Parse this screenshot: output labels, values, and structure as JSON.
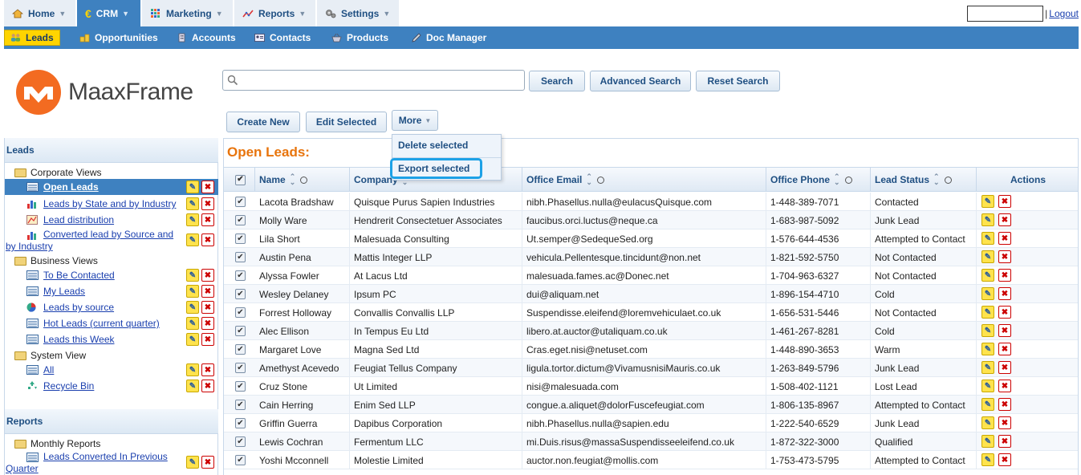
{
  "top_nav": {
    "tabs": [
      {
        "label": "Home",
        "icon": "home-icon"
      },
      {
        "label": "CRM",
        "icon": "euro-icon"
      },
      {
        "label": "Marketing",
        "icon": "grid-icon"
      },
      {
        "label": "Reports",
        "icon": "chart-line-icon"
      },
      {
        "label": "Settings",
        "icon": "gears-icon"
      }
    ],
    "logout_separator": "|",
    "logout_label": "Logout"
  },
  "sub_nav": {
    "items": [
      {
        "label": "Leads",
        "icon": "people-icon"
      },
      {
        "label": "Opportunities",
        "icon": "coins-icon"
      },
      {
        "label": "Accounts",
        "icon": "building-icon"
      },
      {
        "label": "Contacts",
        "icon": "contact-card-icon"
      },
      {
        "label": "Products",
        "icon": "basket-icon"
      },
      {
        "label": "Doc Manager",
        "icon": "pen-icon"
      }
    ]
  },
  "brand": {
    "name": "MaaxFrame",
    "color": "#f36b21"
  },
  "search": {
    "placeholder": "",
    "search_label": "Search",
    "advanced_label": "Advanced Search",
    "reset_label": "Reset Search"
  },
  "toolbar": {
    "create_label": "Create New",
    "edit_label": "Edit Selected",
    "more_label": "More"
  },
  "more_menu": {
    "delete_label": "Delete selected",
    "export_label": "Export selected"
  },
  "sidebar": {
    "leads_header": "Leads",
    "corporate_folder": "Corporate Views",
    "corporate_items": [
      "Open Leads",
      "Leads by State and by Industry",
      "Lead distribution",
      "Converted lead by Source and by Industry"
    ],
    "business_folder": "Business Views",
    "business_items": [
      "To Be Contacted",
      "My Leads",
      "Leads by source",
      "Hot Leads (current quarter)",
      "Leads this Week"
    ],
    "system_folder": "System View",
    "system_items": [
      "All",
      "Recycle Bin"
    ],
    "reports_header": "Reports",
    "monthly_folder": "Monthly Reports",
    "monthly_items": [
      "Leads Converted In Previous Quarter"
    ]
  },
  "grid": {
    "title": "Open Leads:",
    "columns": {
      "name": "Name",
      "company": "Company",
      "email": "Office Email",
      "phone": "Office Phone",
      "status": "Lead Status",
      "actions": "Actions"
    },
    "rows": [
      {
        "name": "Lacota Bradshaw",
        "company": "Quisque Purus Sapien Industries",
        "email": "nibh.Phasellus.nulla@eulacusQuisque.com",
        "phone": "1-448-389-7071",
        "status": "Contacted"
      },
      {
        "name": "Molly Ware",
        "company": "Hendrerit Consectetuer Associates",
        "email": "faucibus.orci.luctus@neque.ca",
        "phone": "1-683-987-5092",
        "status": "Junk Lead"
      },
      {
        "name": "Lila Short",
        "company": "Malesuada Consulting",
        "email": "Ut.semper@SedequeSed.org",
        "phone": "1-576-644-4536",
        "status": "Attempted to Contact"
      },
      {
        "name": "Austin Pena",
        "company": "Mattis Integer LLP",
        "email": "vehicula.Pellentesque.tincidunt@non.net",
        "phone": "1-821-592-5750",
        "status": "Not Contacted"
      },
      {
        "name": "Alyssa Fowler",
        "company": "At Lacus Ltd",
        "email": "malesuada.fames.ac@Donec.net",
        "phone": "1-704-963-6327",
        "status": "Not Contacted"
      },
      {
        "name": "Wesley Delaney",
        "company": "Ipsum PC",
        "email": "dui@aliquam.net",
        "phone": "1-896-154-4710",
        "status": "Cold"
      },
      {
        "name": "Forrest Holloway",
        "company": "Convallis Convallis LLP",
        "email": "Suspendisse.eleifend@loremvehiculaet.co.uk",
        "phone": "1-656-531-5446",
        "status": "Not Contacted"
      },
      {
        "name": "Alec Ellison",
        "company": "In Tempus Eu Ltd",
        "email": "libero.at.auctor@utaliquam.co.uk",
        "phone": "1-461-267-8281",
        "status": "Cold"
      },
      {
        "name": "Margaret Love",
        "company": "Magna Sed Ltd",
        "email": "Cras.eget.nisi@netuset.com",
        "phone": "1-448-890-3653",
        "status": "Warm"
      },
      {
        "name": "Amethyst Acevedo",
        "company": "Feugiat Tellus Company",
        "email": "ligula.tortor.dictum@VivamusnisiMauris.co.uk",
        "phone": "1-263-849-5796",
        "status": "Junk Lead"
      },
      {
        "name": "Cruz Stone",
        "company": "Ut Limited",
        "email": "nisi@malesuada.com",
        "phone": "1-508-402-1121",
        "status": "Lost Lead"
      },
      {
        "name": "Cain Herring",
        "company": "Enim Sed LLP",
        "email": "congue.a.aliquet@dolorFuscefeugiat.com",
        "phone": "1-806-135-8967",
        "status": "Attempted to Contact"
      },
      {
        "name": "Griffin Guerra",
        "company": "Dapibus Corporation",
        "email": "nibh.Phasellus.nulla@sapien.edu",
        "phone": "1-222-540-6529",
        "status": "Junk Lead"
      },
      {
        "name": "Lewis Cochran",
        "company": "Fermentum LLC",
        "email": "mi.Duis.risus@massaSuspendisseeleifend.co.uk",
        "phone": "1-872-322-3000",
        "status": "Qualified"
      },
      {
        "name": "Yoshi Mcconnell",
        "company": "Molestie Limited",
        "email": "auctor.non.feugiat@mollis.com",
        "phone": "1-753-473-5795",
        "status": "Attempted to Contact"
      }
    ]
  }
}
